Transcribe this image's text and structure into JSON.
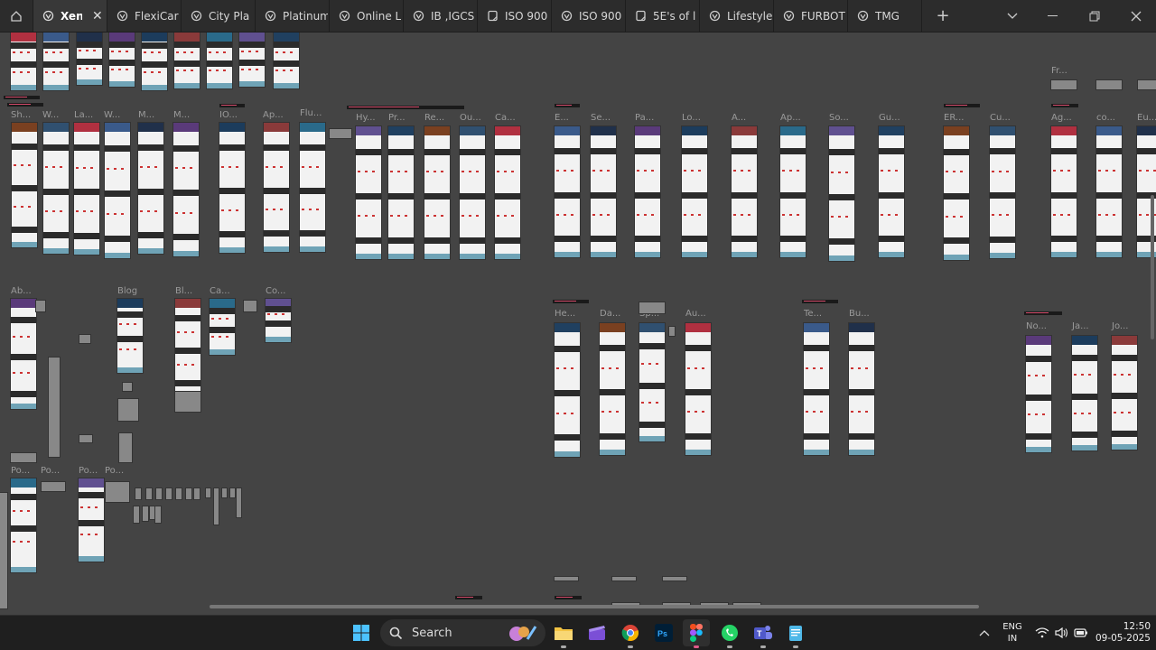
{
  "tabs": [
    {
      "label": "Xen",
      "icon": "component-icon",
      "active": true
    },
    {
      "label": "FlexiCar",
      "icon": "component-icon"
    },
    {
      "label": "City Pla",
      "icon": "component-icon"
    },
    {
      "label": "Platinum",
      "icon": "component-icon"
    },
    {
      "label": "Online L",
      "icon": "component-icon"
    },
    {
      "label": "IB ,IGCS",
      "icon": "component-icon"
    },
    {
      "label": "ISO 900",
      "icon": "file-icon"
    },
    {
      "label": "ISO 900",
      "icon": "component-icon"
    },
    {
      "label": "5E's of l",
      "icon": "file-icon"
    },
    {
      "label": "Lifestyle",
      "icon": "component-icon"
    },
    {
      "label": "FURBOT",
      "icon": "component-icon"
    },
    {
      "label": "TMG",
      "icon": "component-icon"
    }
  ],
  "canvas": {
    "frame_titles": [
      "Fr...",
      "Sh...",
      "W...",
      "La...",
      "W...",
      "M...",
      "M...",
      "IO...",
      "Ap...",
      "Flu...",
      "Hy...",
      "Pr...",
      "Re...",
      "Ou...",
      "Ca...",
      "E...",
      "Se...",
      "Pa...",
      "Lo...",
      "A...",
      "Ap...",
      "So...",
      "Gu...",
      "ER...",
      "Cu...",
      "Ag...",
      "co...",
      "Eu...",
      "Ab...",
      "Blog",
      "Bl...",
      "Ca...",
      "Co...",
      "He...",
      "Da...",
      "Sp...",
      "Au...",
      "Te...",
      "Bu...",
      "No...",
      "Ja...",
      "Jo...",
      "Po...",
      "Po...",
      "Po...",
      "Po..."
    ]
  },
  "taskbar": {
    "search_label": "Search",
    "apps": [
      "start-icon",
      "widgets-icon",
      "file-explorer-icon",
      "clapper-icon",
      "chrome-icon",
      "photoshop-icon",
      "figma-icon",
      "whatsapp-icon",
      "teams-icon",
      "notepad-icon"
    ],
    "lang_primary": "ENG",
    "lang_secondary": "IN",
    "time": "12:50",
    "date": "09-05-2025"
  },
  "colors": {
    "accent": "#d44a6a",
    "tabbar": "#2c2c2c",
    "canvas": "#444444",
    "taskbar": "#1f1f1f"
  }
}
